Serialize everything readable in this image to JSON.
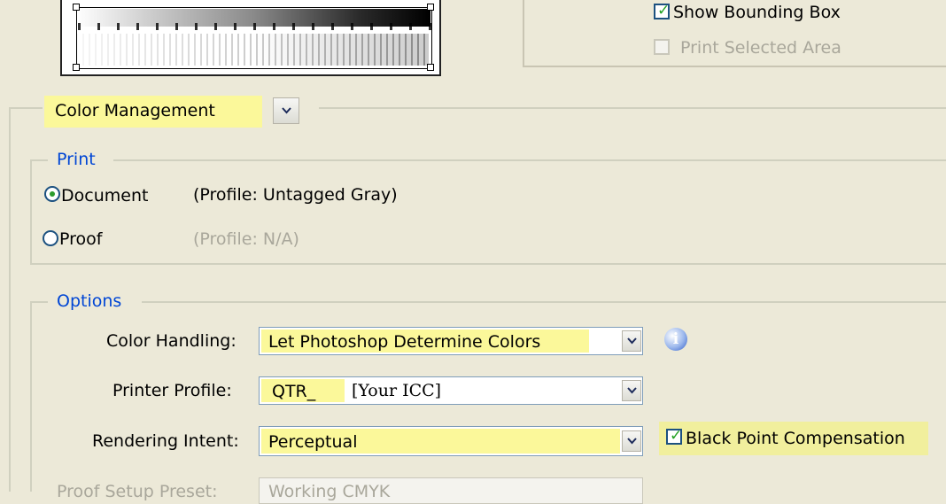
{
  "top_options": {
    "show_bounding_box": {
      "label": "Show Bounding Box",
      "checked": true
    },
    "print_selected_area": {
      "label": "Print Selected Area",
      "checked": false,
      "disabled": true
    }
  },
  "section_select": {
    "value": "Color Management"
  },
  "print_group": {
    "title": "Print",
    "document": {
      "label": "Document",
      "profile": "(Profile: Untagged Gray)",
      "selected": true
    },
    "proof": {
      "label": "Proof",
      "profile": "(Profile: N/A)",
      "selected": false
    }
  },
  "options_group": {
    "title": "Options",
    "color_handling": {
      "label": "Color Handling:",
      "value": "Let Photoshop Determine Colors"
    },
    "printer_profile": {
      "label": "Printer Profile:",
      "value": "QTR_",
      "value_note": "[Your ICC]"
    },
    "rendering_intent": {
      "label": "Rendering Intent:",
      "value": "Perceptual"
    },
    "black_point_compensation": {
      "label": "Black Point Compensation",
      "checked": true
    },
    "proof_setup_preset": {
      "label": "Proof Setup Preset:",
      "value": "Working CMYK"
    }
  },
  "colors": {
    "highlight": "#fbf89a",
    "link_blue": "#0046d5",
    "window_bg": "#ece9d8",
    "check_green": "#21a121"
  },
  "icons": {
    "info": "info-icon",
    "dropdown": "chevron-down-icon"
  }
}
